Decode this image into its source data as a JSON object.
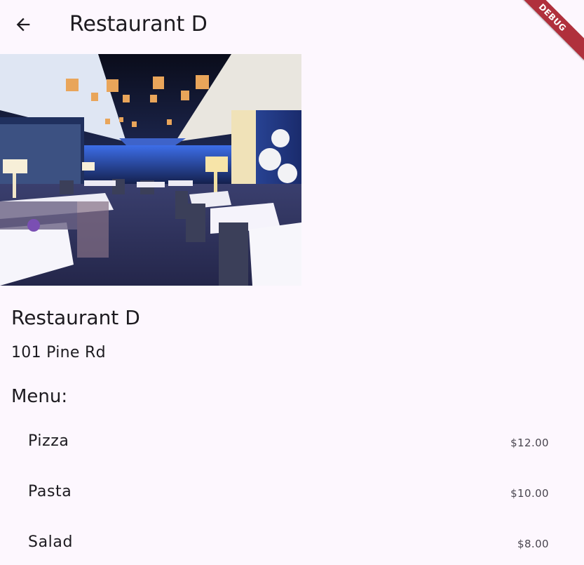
{
  "appbar": {
    "title": "Restaurant D",
    "back_icon": "arrow-left-icon"
  },
  "debug_banner": "DEBUG",
  "restaurant": {
    "image": "restaurant-dining-room-photo",
    "name": "Restaurant D",
    "address": "101 Pine Rd"
  },
  "menu": {
    "heading": "Menu:",
    "items": [
      {
        "name": "Pizza",
        "price": "$12.00"
      },
      {
        "name": "Pasta",
        "price": "$10.00"
      },
      {
        "name": "Salad",
        "price": "$8.00"
      }
    ]
  },
  "colors": {
    "background": "#fdf7fe",
    "text": "#1d1b20",
    "secondary_text": "#49454f",
    "debug_ribbon": "#b0303c"
  }
}
